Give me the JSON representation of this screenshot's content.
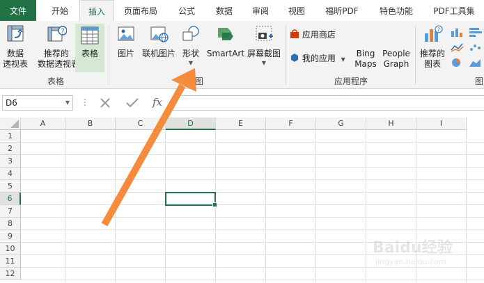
{
  "tabs": {
    "file": "文件",
    "home": "开始",
    "insert": "插入",
    "page_layout": "页面布局",
    "formulas": "公式",
    "data": "数据",
    "review": "审阅",
    "view": "视图",
    "foxit_pdf": "福昕PDF",
    "special": "特色功能",
    "pdf_tools": "PDF工具集"
  },
  "ribbon": {
    "pivot_line1": "数据",
    "pivot_line2": "透视表",
    "rec_pivot_line1": "推荐的",
    "rec_pivot_line2": "数据透视表",
    "table": "表格",
    "group_tables": "表格",
    "pictures": "图片",
    "online_pictures": "联机图片",
    "shapes": "形状",
    "smartart": "SmartArt",
    "screenshot": "屏幕截图",
    "group_illustrations": "插图",
    "app_store": "应用商店",
    "my_apps": "我的应用",
    "bing_line1": "Bing",
    "bing_line2": "Maps",
    "people_line1": "People",
    "people_line2": "Graph",
    "group_apps": "应用程序",
    "rec_charts_line1": "推荐的",
    "rec_charts_line2": "图表",
    "group_charts_partial": "图"
  },
  "formula_bar": {
    "name_box": "D6",
    "fx": "fx",
    "value": ""
  },
  "sheet": {
    "columns": [
      "A",
      "B",
      "C",
      "D",
      "E",
      "F",
      "G",
      "H",
      "I"
    ],
    "rows": [
      "1",
      "2",
      "3",
      "4",
      "5",
      "6",
      "7",
      "8",
      "9",
      "10",
      "11",
      "12"
    ],
    "selected_cell": "D6"
  },
  "watermark": {
    "brand": "Baidu经验",
    "url": "jingyan.baidu.com"
  },
  "colors": {
    "excel_green": "#217346",
    "arrow_orange": "#f58b3c"
  }
}
